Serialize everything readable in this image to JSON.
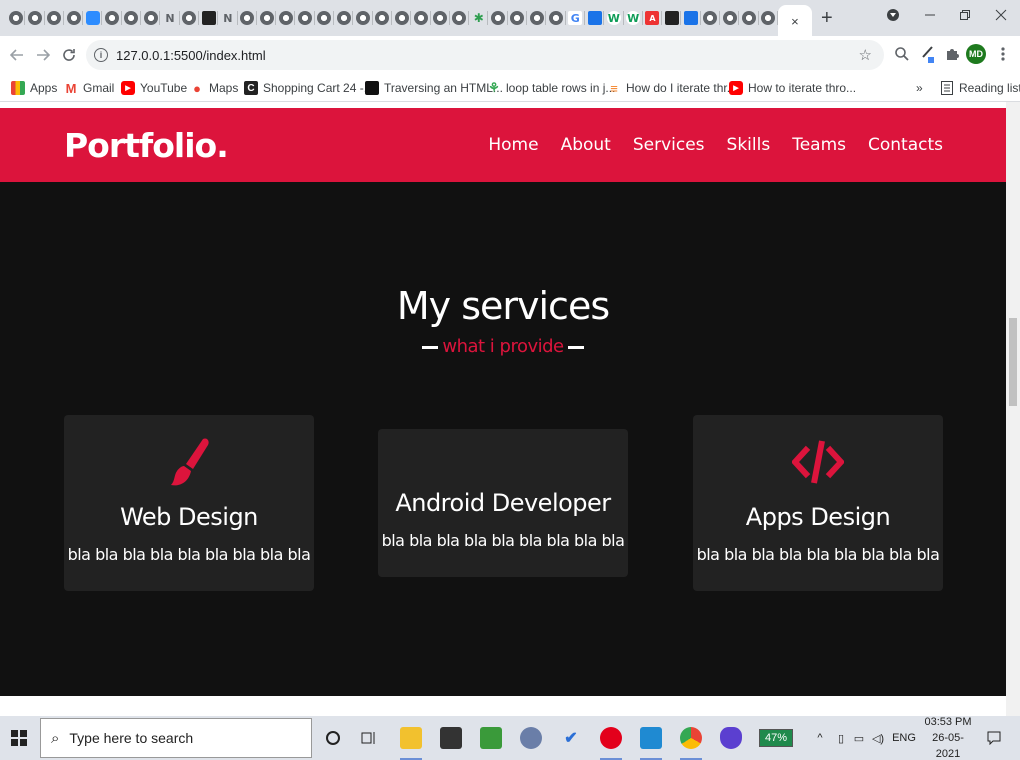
{
  "browser": {
    "tabs": [
      {
        "icon": "globe-icon"
      },
      {
        "icon": "globe-icon"
      },
      {
        "icon": "globe-icon"
      },
      {
        "icon": "globe-icon"
      },
      {
        "icon": "zoom-icon"
      },
      {
        "icon": "globe-icon"
      },
      {
        "icon": "globe-icon"
      },
      {
        "icon": "globe-icon"
      },
      {
        "icon": "n-icon",
        "letter": "N"
      },
      {
        "icon": "globe-icon"
      },
      {
        "icon": "mobile-icon"
      },
      {
        "icon": "n-icon",
        "letter": "N"
      },
      {
        "icon": "globe-icon"
      },
      {
        "icon": "globe-icon"
      },
      {
        "icon": "globe-icon"
      },
      {
        "icon": "globe-icon"
      },
      {
        "icon": "globe-icon"
      },
      {
        "icon": "globe-icon"
      },
      {
        "icon": "globe-icon"
      },
      {
        "icon": "globe-icon"
      },
      {
        "icon": "globe-icon"
      },
      {
        "icon": "globe-icon"
      },
      {
        "icon": "globe-icon"
      },
      {
        "icon": "globe-icon"
      },
      {
        "icon": "star-icon"
      },
      {
        "icon": "globe-icon"
      },
      {
        "icon": "globe-icon"
      },
      {
        "icon": "globe-icon"
      },
      {
        "icon": "globe-icon"
      },
      {
        "icon": "g-icon",
        "letter": "G"
      },
      {
        "icon": "bookmark-blue-icon"
      },
      {
        "icon": "w-icon",
        "letter": "W"
      },
      {
        "icon": "w-icon",
        "letter": "W"
      },
      {
        "icon": "a-icon",
        "letter": "A"
      },
      {
        "icon": "flag-icon"
      },
      {
        "icon": "bookmark-blue-icon"
      },
      {
        "icon": "globe-icon"
      },
      {
        "icon": "globe-icon"
      },
      {
        "icon": "globe-icon"
      },
      {
        "icon": "globe-icon"
      }
    ],
    "active_tab_close": "×",
    "new_tab": "+",
    "url": "127.0.0.1:5500/index.html",
    "profile_initials": "MD",
    "bookmarks": [
      {
        "label": "Apps",
        "icon": "apps-icon"
      },
      {
        "label": "Gmail",
        "icon": "gmail-icon"
      },
      {
        "label": "YouTube",
        "icon": "youtube-icon"
      },
      {
        "label": "Maps",
        "icon": "maps-icon"
      },
      {
        "label": "Shopping Cart 24 -...",
        "icon": "cart-icon"
      },
      {
        "label": "Traversing an HTML...",
        "icon": "page-icon"
      },
      {
        "label": "loop table rows in j...",
        "icon": "tree-icon"
      },
      {
        "label": "How do I iterate thr...",
        "icon": "stackoverflow-icon"
      },
      {
        "label": "How to iterate thro...",
        "icon": "youtube-icon"
      }
    ],
    "bookmarks_overflow": "»",
    "reading_list": "Reading list"
  },
  "site": {
    "logo": "Portfolio.",
    "nav": [
      "Home",
      "About",
      "Services",
      "Skills",
      "Teams",
      "Contacts"
    ],
    "section_title": "My services",
    "section_subtitle": "what i provide",
    "cards": [
      {
        "title": "Web Design",
        "text": "bla bla bla bla bla bla bla bla bla",
        "icon": "paint-brush-icon"
      },
      {
        "title": "Android Developer",
        "text": "bla bla bla bla bla bla bla bla bla",
        "icon": "android-icon"
      },
      {
        "title": "Apps Design",
        "text": "bla bla bla bla bla bla bla bla bla",
        "icon": "code-icon"
      }
    ],
    "colors": {
      "accent": "#dc143c",
      "background": "#111111",
      "card": "#222222"
    }
  },
  "taskbar": {
    "search_placeholder": "Type here to search",
    "battery": "47%",
    "language": "ENG",
    "time": "03:53 PM",
    "date": "26-05-2021"
  }
}
